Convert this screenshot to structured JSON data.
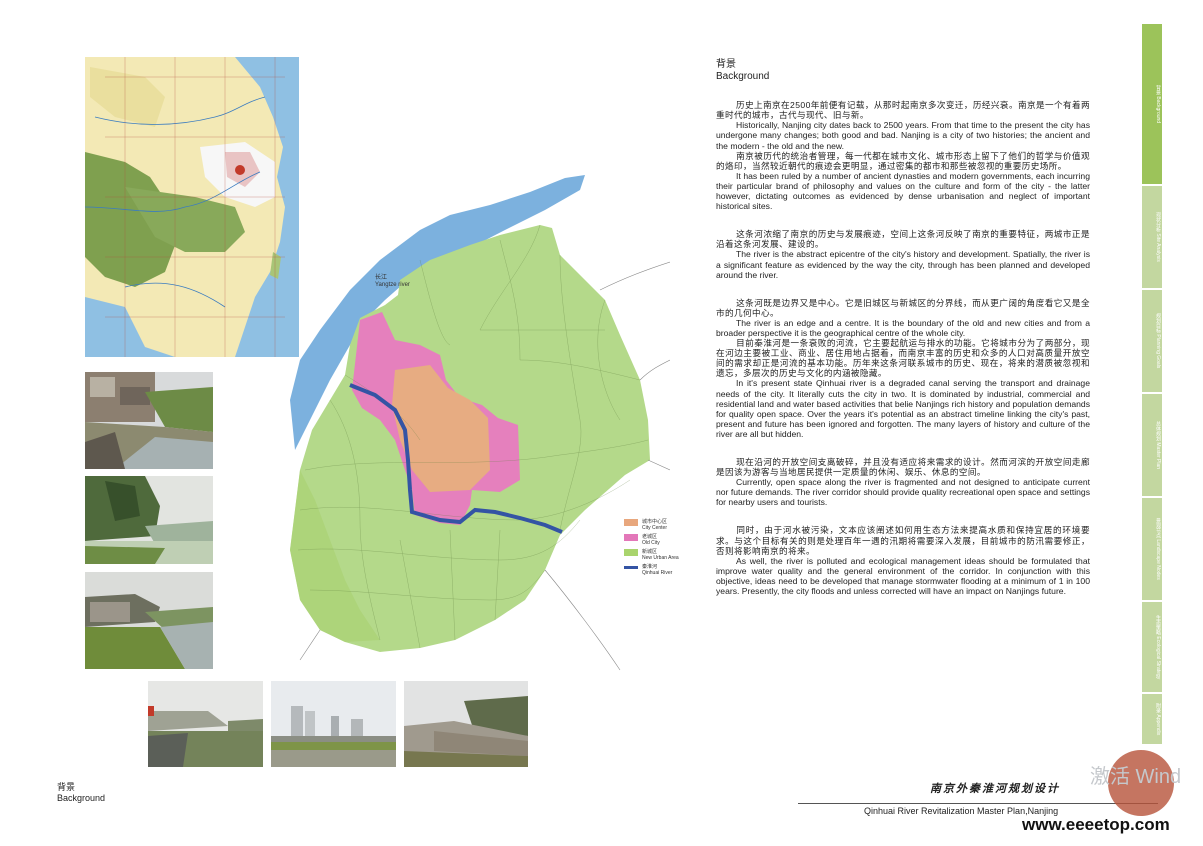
{
  "page": {
    "bottom_label_zh": "背景",
    "bottom_label_en": "Background",
    "footer_title_zh": "南京外秦淮河规划设计",
    "footer_title_en": "Qinhuai River Revitalization Master Plan,Nanjing",
    "watermark_site": "www.eeeetop.com",
    "watermark_activate": "激活 Wind"
  },
  "map": {
    "river_label_zh": "长江",
    "river_label_en": "Yangtze river",
    "legend": [
      {
        "zh": "城市中心区",
        "en": "City Center",
        "color": "#e8a77d"
      },
      {
        "zh": "老城区",
        "en": "Old City",
        "color": "#e377b9"
      },
      {
        "zh": "新城区",
        "en": "New Urban Area",
        "color": "#a9d46d"
      },
      {
        "zh": "秦淮河",
        "en": "Qinhuai River",
        "color": "#3454a4"
      }
    ]
  },
  "sidebar": {
    "tabs": [
      "背景 Background",
      "现状分析 Site Analysis",
      "规划目标 Planning Goals",
      "总体规划 Master Plan",
      "景观节点 Landscape Nodes",
      "生态策略 Ecological Strategy",
      "附录 Appendix"
    ]
  },
  "text": {
    "heading_zh": "背景",
    "heading_en": "Background",
    "p1_zh": "历史上南京在2500年前便有记载，从那时起南京多次变迁，历经兴衰。南京是一个有着两重时代的城市，古代与现代、旧与新。",
    "p1_en": "Historically, Nanjing city dates back to 2500 years.  From that time to the present the city has undergone many changes; both good and bad.  Nanjing is a city of two histories; the ancient and the modern - the old and the new.",
    "p2_zh": "南京被历代的统治者管理，每一代都在城市文化、城市形态上留下了他们的哲学与价值观的烙印，当然较近朝代的痕迹会更明显，通过密集的都市和那些被忽视的重要历史场所。",
    "p2_en": "It has been ruled by a number of ancient dynasties and modern governments, each incurring their particular brand of philosophy and values on the culture and form of the city - the latter however, dictating outcomes as evidenced by dense urbanisation and neglect of important historical sites.",
    "p3_zh": "这条河浓缩了南京的历史与发展痕迹，空间上这条河反映了南京的重要特征，两城市正是沿着这条河发展、建设的。",
    "p3_en": "The river is the abstract epicentre of the city's history and development.  Spatially, the river is a significant feature as evidenced by the way the city, through has been planned and developed around the river.",
    "p4_zh": "这条河既是边界又是中心。它是旧城区与新城区的分界线，而从更广阔的角度看它又是全市的几何中心。",
    "p4_en": "The river is an edge and a centre.  It is the boundary of the old and new cities and from a broader perspective it is the geographical centre of the whole city.",
    "p5_zh": "目前秦淮河是一条衰败的河流，它主要起航运与排水的功能。它将城市分为了两部分，现在河边主要被工业、商业、居住用地占据着，而南京丰富的历史和众多的人口对高质量开放空间的需求却正是河流的基本功能。历年来这条河联系城市的历史、现在，将来的潜质被忽视和遗忘，多层次的历史与文化的内涵被隐藏。",
    "p5_en": "In it's present state Qinhuai river is a degraded canal serving the transport and drainage needs of the city.  It literally cuts the city in two.  It is dominated by industrial, commercial and residential land and water based activities that belie Nanjings rich history and population demands for quality open space.   Over the years it's potential as an abstract timeline linking the city's past, present and future has been ignored and forgotten.  The many layers of history and culture of the river are all but hidden.",
    "p6_zh": "现在沿河的开放空间支离破碎，并且没有适应将来需求的设计。然而河滨的开放空间走廊是因该为游客与当地居民提供一定质量的休闲、娱乐、休息的空间。",
    "p6_en": "Currently, open space along the river is fragmented and not designed to anticipate current nor future demands.  The river corridor should provide quality recreational open space and settings for nearby users and tourists.",
    "p7_zh": "同时，由于河水被污染，文本应该阐述如何用生态方法来提高水质和保持宜居的环境要求。与这个目标有关的则是处理百年一遇的汛期将需要深入发展，目前城市的防汛需要修正，否则将影响南京的将来。",
    "p7_en": "As well, the river is polluted and ecological management ideas should be formulated that improve water quality and the general environment of the corridor.  In conjunction with this objective, ideas need to be developed that manage stormwater flooding at a minimum of 1 in 100 years.  Presently, the city floods and unless corrected will have an impact on Nanjings future."
  }
}
